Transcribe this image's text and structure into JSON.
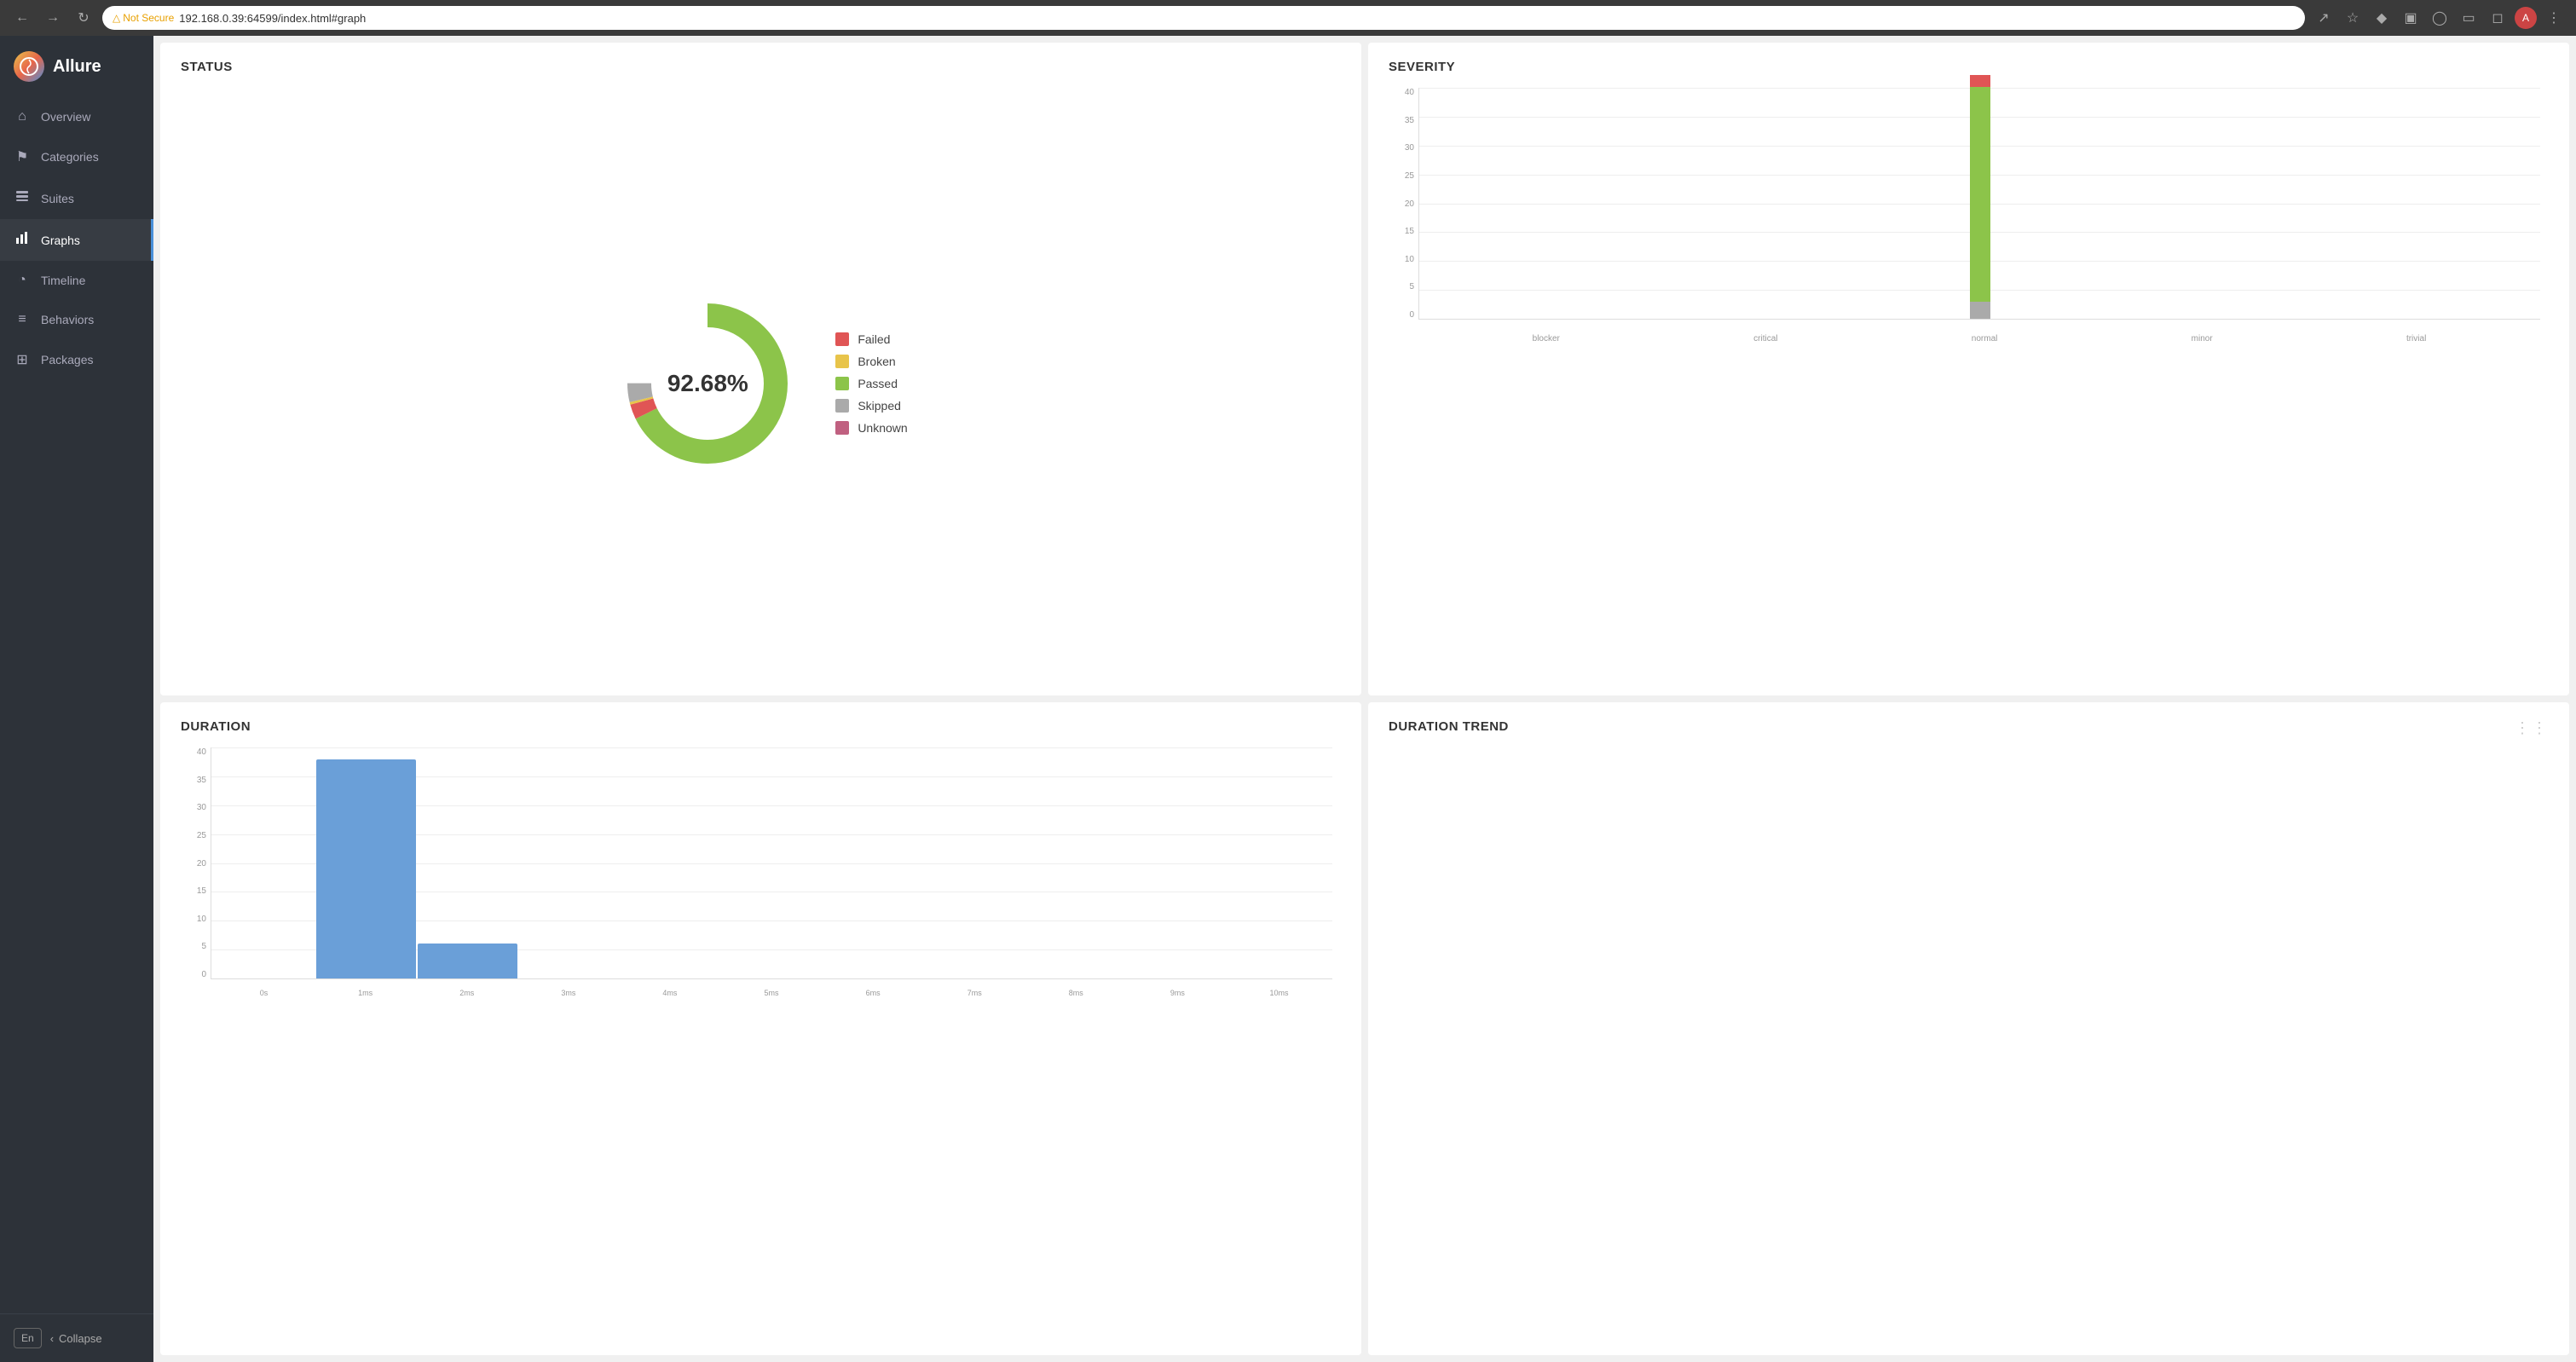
{
  "browser": {
    "url": "192.168.0.39:64599/index.html#graph",
    "not_secure_label": "Not Secure"
  },
  "sidebar": {
    "logo_text": "Allure",
    "items": [
      {
        "id": "overview",
        "label": "Overview",
        "icon": "⌂",
        "active": false
      },
      {
        "id": "categories",
        "label": "Categories",
        "icon": "⚑",
        "active": false
      },
      {
        "id": "suites",
        "label": "Suites",
        "icon": "☰",
        "active": false
      },
      {
        "id": "graphs",
        "label": "Graphs",
        "icon": "▦",
        "active": true
      },
      {
        "id": "timeline",
        "label": "Timeline",
        "icon": "◔",
        "active": false
      },
      {
        "id": "behaviors",
        "label": "Behaviors",
        "icon": "≡",
        "active": false
      },
      {
        "id": "packages",
        "label": "Packages",
        "icon": "⊞",
        "active": false
      }
    ],
    "lang_btn": "En",
    "collapse_label": "Collapse"
  },
  "status_panel": {
    "title": "STATUS",
    "percentage": "92.68%",
    "donut": {
      "failed_pct": 3,
      "broken_pct": 0.5,
      "passed_pct": 92.68,
      "skipped_pct": 3.82,
      "unknown_pct": 0
    },
    "legend": [
      {
        "id": "failed",
        "label": "Failed",
        "color": "#e05555"
      },
      {
        "id": "broken",
        "label": "Broken",
        "color": "#e8c44a"
      },
      {
        "id": "passed",
        "label": "Passed",
        "color": "#8cc44a"
      },
      {
        "id": "skipped",
        "label": "Skipped",
        "color": "#aaa"
      },
      {
        "id": "unknown",
        "label": "Unknown",
        "color": "#c06080"
      }
    ]
  },
  "severity_panel": {
    "title": "SEVERITY",
    "y_labels": [
      "0",
      "5",
      "10",
      "15",
      "20",
      "25",
      "30",
      "35",
      "40"
    ],
    "bars": [
      {
        "label": "blocker",
        "value": 0,
        "color": "#e05555"
      },
      {
        "label": "critical",
        "value": 0,
        "color": "#e05555"
      },
      {
        "label": "normal",
        "value": 2.5,
        "color": "#e05555",
        "has_green": true,
        "green_value": 37,
        "gray_value": 3
      },
      {
        "label": "minor",
        "value": 0,
        "color": "#aaa"
      },
      {
        "label": "trivial",
        "value": 0,
        "color": "#aaa"
      }
    ]
  },
  "duration_panel": {
    "title": "DURATION",
    "y_labels": [
      "0",
      "5",
      "10",
      "15",
      "20",
      "25",
      "30",
      "35",
      "40"
    ],
    "x_labels": [
      "0s",
      "1ms",
      "2ms",
      "3ms",
      "4ms",
      "5ms",
      "6ms",
      "7ms",
      "8ms",
      "9ms",
      "10ms"
    ],
    "bars": [
      {
        "label": "0s",
        "value": 0
      },
      {
        "label": "1ms",
        "value": 38
      },
      {
        "label": "2ms",
        "value": 6
      },
      {
        "label": "3ms",
        "value": 0
      },
      {
        "label": "4ms",
        "value": 0
      },
      {
        "label": "5ms",
        "value": 0
      },
      {
        "label": "6ms",
        "value": 0
      },
      {
        "label": "7ms",
        "value": 0
      },
      {
        "label": "8ms",
        "value": 0
      },
      {
        "label": "9ms",
        "value": 0
      },
      {
        "label": "10ms",
        "value": 0
      }
    ]
  },
  "duration_trend_panel": {
    "title": "DURATION TREND"
  },
  "colors": {
    "failed": "#e05555",
    "broken": "#e8c44a",
    "passed": "#8cc44a",
    "skipped": "#aaaaaa",
    "unknown": "#c06080",
    "blue_bar": "#6a9fd8",
    "sidebar_active": "#4a90d9"
  }
}
